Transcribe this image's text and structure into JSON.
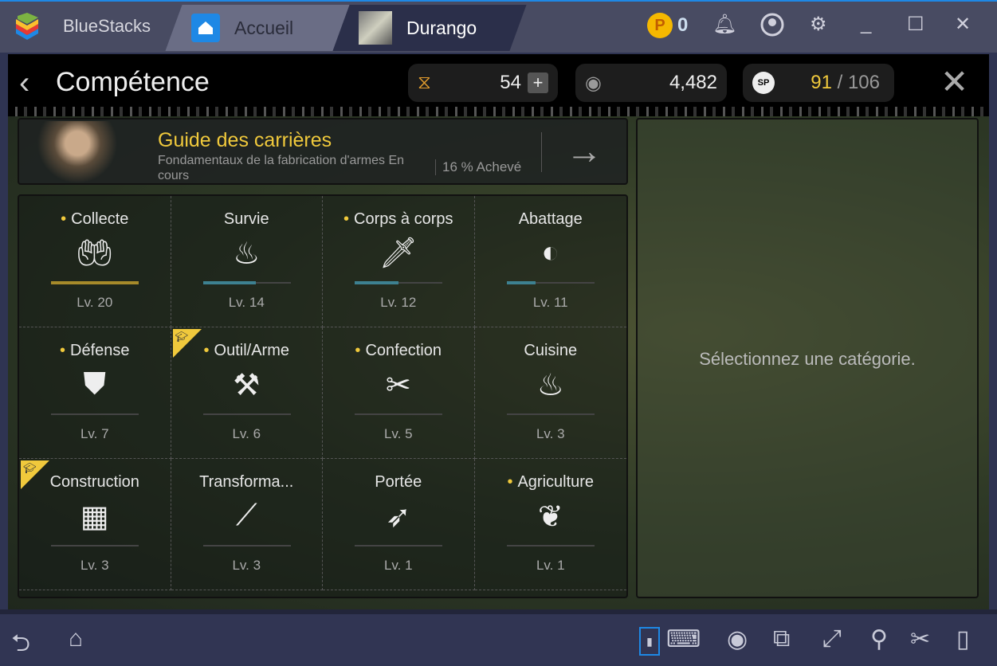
{
  "window": {
    "brand": "BlueStacks",
    "tabs": [
      {
        "label": "Accueil"
      },
      {
        "label": "Durango"
      }
    ],
    "coins": "0",
    "icons": [
      "coin-icon",
      "bell-icon",
      "account-icon",
      "gear-icon",
      "minimize-icon",
      "maximize-icon",
      "close-icon"
    ]
  },
  "header": {
    "title": "Compétence",
    "energy": "54",
    "currency": "4,482",
    "sp_current": "91",
    "sp_total": "/ 106"
  },
  "guide": {
    "title": "Guide des carrières",
    "subtitle": "Fondamentaux de la fabrication d'armes En cours",
    "progress": "16 % Achevé"
  },
  "skills": [
    {
      "name": "Collecte",
      "level": "Lv. 20",
      "dot": true,
      "icon": "gather-icon",
      "progress": 1.0,
      "max": true
    },
    {
      "name": "Survie",
      "level": "Lv. 14",
      "dot": false,
      "icon": "campfire-icon",
      "progress": 0.6
    },
    {
      "name": "Corps à corps",
      "level": "Lv. 12",
      "dot": true,
      "icon": "knife-icon",
      "progress": 0.5
    },
    {
      "name": "Abattage",
      "level": "Lv. 11",
      "dot": false,
      "icon": "meat-icon",
      "progress": 0.33
    },
    {
      "name": "Défense",
      "level": "Lv. 7",
      "dot": true,
      "icon": "shield-icon",
      "progress": 0
    },
    {
      "name": "Outil/Arme",
      "level": "Lv. 6",
      "dot": true,
      "icon": "anvil-icon",
      "progress": 0,
      "career_badge": true
    },
    {
      "name": "Confection",
      "level": "Lv. 5",
      "dot": true,
      "icon": "scissors-icon",
      "progress": 0
    },
    {
      "name": "Cuisine",
      "level": "Lv. 3",
      "dot": false,
      "icon": "cooking-pot-icon",
      "progress": 0
    },
    {
      "name": "Construction",
      "level": "Lv. 3",
      "dot": false,
      "icon": "bricks-icon",
      "progress": 0,
      "career_badge": true
    },
    {
      "name": "Transforma...",
      "level": "Lv. 3",
      "dot": false,
      "icon": "wood-icon",
      "progress": 0
    },
    {
      "name": "Portée",
      "level": "Lv. 1",
      "dot": false,
      "icon": "bow-icon",
      "progress": 0
    },
    {
      "name": "Agriculture",
      "level": "Lv. 1",
      "dot": true,
      "icon": "plant-icon",
      "progress": 0
    }
  ],
  "detail": {
    "message": "Sélectionnez une catégorie."
  },
  "colors": {
    "accent": "#f0c93c",
    "progress": "#3d8191",
    "titlebar": "#484b62"
  }
}
